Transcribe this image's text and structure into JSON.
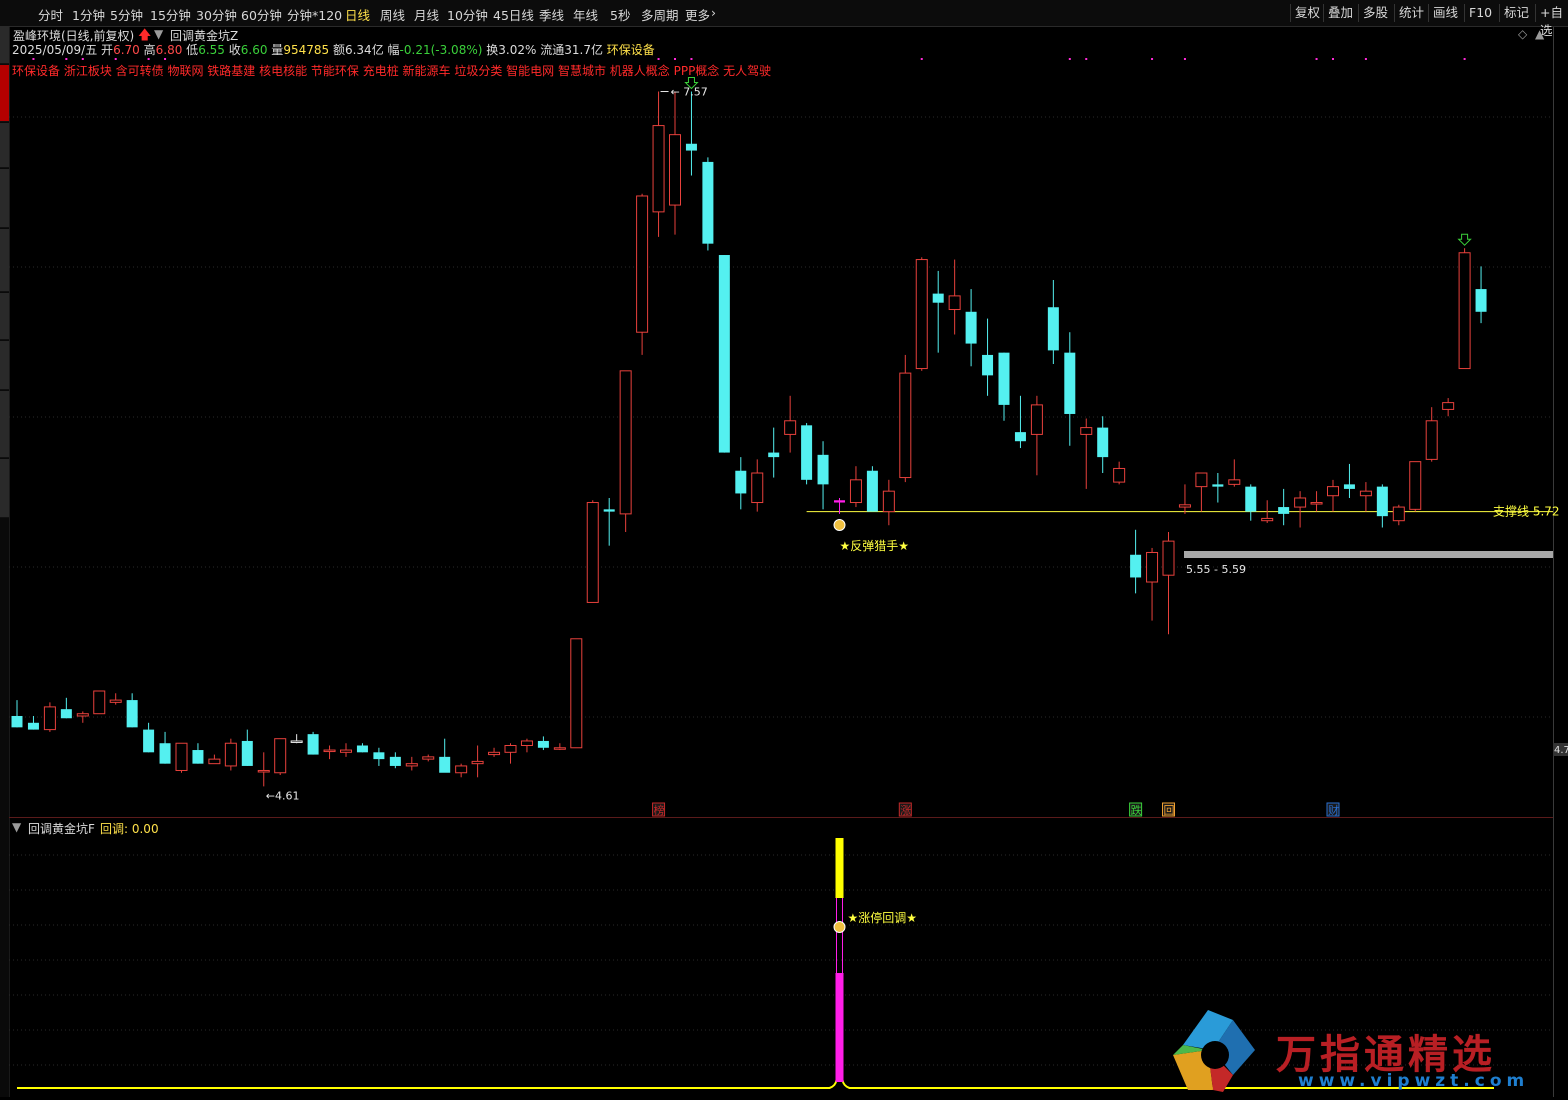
{
  "toolbar": {
    "left": [
      {
        "label": "分时",
        "active": false
      },
      {
        "label": "1分钟",
        "active": false
      },
      {
        "label": "5分钟",
        "active": false
      },
      {
        "label": "15分钟",
        "active": false
      },
      {
        "label": "30分钟",
        "active": false
      },
      {
        "label": "60分钟",
        "active": false
      },
      {
        "label": "分钟*120",
        "active": false
      },
      {
        "label": "日线",
        "active": true
      },
      {
        "label": "周线",
        "active": false
      },
      {
        "label": "月线",
        "active": false
      },
      {
        "label": "10分钟",
        "active": false
      },
      {
        "label": "45日线",
        "active": false
      },
      {
        "label": "季线",
        "active": false
      },
      {
        "label": "年线",
        "active": false
      },
      {
        "label": "5秒",
        "active": false
      },
      {
        "label": "多周期",
        "active": false
      },
      {
        "label": "更多",
        "active": false
      }
    ],
    "right": [
      "复权",
      "叠加",
      "多股",
      "统计",
      "画线",
      "F10",
      "标记",
      "+自选"
    ]
  },
  "header": {
    "stock_title": "盈峰环境(日线,前复权)",
    "indicator_name": "回调黄金坑Z",
    "date": "2025/05/09/五",
    "open_label": "开",
    "open": "6.70",
    "high_label": "高",
    "high": "6.80",
    "low_label": "低",
    "low": "6.55",
    "close_label": "收",
    "close": "6.60",
    "volume_label": "量",
    "volume": "954785",
    "amount_label": "额",
    "amount": "6.34亿",
    "change_label": "幅",
    "change": "-0.21(-3.08%)",
    "turnover_label": "换",
    "turnover": "3.02%",
    "float_label": "流通",
    "float_value": "31.7亿",
    "industry": "环保设备",
    "concepts": "环保设备 浙江板块 含可转债 物联网 铁路基建 核电核能 节能环保 充电桩 新能源车 垃圾分类 智能电网 智慧城市 机器人概念 PPP概念 无人驾驶"
  },
  "main_chart_labels": {
    "high_marker": "7.57",
    "low_marker": "4.61",
    "signal_text": "★反弹猎手★",
    "support_label": "支撑线 5.72",
    "gap_label": "5.55 - 5.59",
    "axis_right_label": "4.7",
    "event_markers": [
      "榜",
      "涨",
      "跌",
      "回",
      "财"
    ]
  },
  "sub_panel": {
    "title": "回调黄金坑F",
    "value_label": "回调: 0.00",
    "signal_text": "★涨停回调★"
  },
  "logo": {
    "text": "万指通精选",
    "url": "www.vipwzt.com"
  },
  "colors": {
    "up": "#e8413c",
    "down": "#54f0f0",
    "signal": "#ff1ee8",
    "yellow": "#ffff00",
    "bg": "#000000"
  },
  "chart_data": {
    "type": "candlestick",
    "support_line": 5.72,
    "gap_zone": [
      5.55,
      5.59
    ],
    "candles": [
      {
        "o": 4.82,
        "h": 4.89,
        "l": 4.77,
        "c": 4.77
      },
      {
        "o": 4.79,
        "h": 4.82,
        "l": 4.76,
        "c": 4.76
      },
      {
        "o": 4.76,
        "h": 4.88,
        "l": 4.75,
        "c": 4.86
      },
      {
        "o": 4.85,
        "h": 4.9,
        "l": 4.81,
        "c": 4.81
      },
      {
        "o": 4.82,
        "h": 4.84,
        "l": 4.79,
        "c": 4.83
      },
      {
        "o": 4.83,
        "h": 4.93,
        "l": 4.83,
        "c": 4.93
      },
      {
        "o": 4.88,
        "h": 4.92,
        "l": 4.87,
        "c": 4.89
      },
      {
        "o": 4.89,
        "h": 4.92,
        "l": 4.77,
        "c": 4.77
      },
      {
        "o": 4.76,
        "h": 4.79,
        "l": 4.66,
        "c": 4.66
      },
      {
        "o": 4.7,
        "h": 4.75,
        "l": 4.61,
        "c": 4.61
      },
      {
        "o": 4.58,
        "h": 4.7,
        "l": 4.57,
        "c": 4.7
      },
      {
        "o": 4.67,
        "h": 4.7,
        "l": 4.61,
        "c": 4.61
      },
      {
        "o": 4.61,
        "h": 4.65,
        "l": 4.61,
        "c": 4.63
      },
      {
        "o": 4.6,
        "h": 4.72,
        "l": 4.58,
        "c": 4.7
      },
      {
        "o": 4.71,
        "h": 4.76,
        "l": 4.6,
        "c": 4.6
      },
      {
        "o": 4.58,
        "h": 4.66,
        "l": 4.51,
        "c": 4.58
      },
      {
        "o": 4.57,
        "h": 4.72,
        "l": 4.56,
        "c": 4.72
      },
      {
        "o": 4.71,
        "h": 4.74,
        "l": 4.7,
        "c": 4.71
      },
      {
        "o": 4.74,
        "h": 4.75,
        "l": 4.65,
        "c": 4.65
      },
      {
        "o": 4.67,
        "h": 4.69,
        "l": 4.63,
        "c": 4.67
      },
      {
        "o": 4.66,
        "h": 4.7,
        "l": 4.64,
        "c": 4.67
      },
      {
        "o": 4.69,
        "h": 4.7,
        "l": 4.66,
        "c": 4.66
      },
      {
        "o": 4.66,
        "h": 4.68,
        "l": 4.6,
        "c": 4.63
      },
      {
        "o": 4.64,
        "h": 4.66,
        "l": 4.59,
        "c": 4.6
      },
      {
        "o": 4.6,
        "h": 4.64,
        "l": 4.58,
        "c": 4.61
      },
      {
        "o": 4.63,
        "h": 4.65,
        "l": 4.62,
        "c": 4.64
      },
      {
        "o": 4.64,
        "h": 4.72,
        "l": 4.58,
        "c": 4.57
      },
      {
        "o": 4.57,
        "h": 4.61,
        "l": 4.55,
        "c": 4.6
      },
      {
        "o": 4.61,
        "h": 4.69,
        "l": 4.55,
        "c": 4.62
      },
      {
        "o": 4.65,
        "h": 4.68,
        "l": 4.64,
        "c": 4.66
      },
      {
        "o": 4.66,
        "h": 4.7,
        "l": 4.61,
        "c": 4.69
      },
      {
        "o": 4.69,
        "h": 4.72,
        "l": 4.66,
        "c": 4.71
      },
      {
        "o": 4.71,
        "h": 4.73,
        "l": 4.67,
        "c": 4.68
      },
      {
        "o": 4.68,
        "h": 4.7,
        "l": 4.67,
        "c": 4.68
      },
      {
        "o": 4.68,
        "h": 5.16,
        "l": 4.68,
        "c": 5.16
      },
      {
        "o": 5.32,
        "h": 5.77,
        "l": 5.32,
        "c": 5.76
      },
      {
        "o": 5.73,
        "h": 5.78,
        "l": 5.57,
        "c": 5.72
      },
      {
        "o": 5.71,
        "h": 6.34,
        "l": 5.63,
        "c": 6.34
      },
      {
        "o": 6.51,
        "h": 7.12,
        "l": 6.41,
        "c": 7.11
      },
      {
        "o": 7.04,
        "h": 7.57,
        "l": 6.93,
        "c": 7.42
      },
      {
        "o": 7.07,
        "h": 7.57,
        "l": 6.94,
        "c": 7.38
      },
      {
        "o": 7.34,
        "h": 7.57,
        "l": 7.2,
        "c": 7.31
      },
      {
        "o": 7.26,
        "h": 7.28,
        "l": 6.87,
        "c": 6.9
      },
      {
        "o": 6.85,
        "h": 6.85,
        "l": 5.98,
        "c": 5.98
      },
      {
        "o": 5.9,
        "h": 5.96,
        "l": 5.73,
        "c": 5.8
      },
      {
        "o": 5.76,
        "h": 5.95,
        "l": 5.72,
        "c": 5.89
      },
      {
        "o": 5.98,
        "h": 6.09,
        "l": 5.87,
        "c": 5.96
      },
      {
        "o": 6.06,
        "h": 6.23,
        "l": 5.98,
        "c": 6.12
      },
      {
        "o": 6.1,
        "h": 6.11,
        "l": 5.84,
        "c": 5.86
      },
      {
        "o": 5.97,
        "h": 6.03,
        "l": 5.73,
        "c": 5.84
      },
      {
        "o": 5.77,
        "h": 5.78,
        "l": 5.71,
        "c": 5.76
      },
      {
        "o": 5.76,
        "h": 5.92,
        "l": 5.74,
        "c": 5.86
      },
      {
        "o": 5.9,
        "h": 5.92,
        "l": 5.72,
        "c": 5.72
      },
      {
        "o": 5.72,
        "h": 5.86,
        "l": 5.66,
        "c": 5.81
      },
      {
        "o": 5.87,
        "h": 6.41,
        "l": 5.85,
        "c": 6.33
      },
      {
        "o": 6.35,
        "h": 6.84,
        "l": 6.34,
        "c": 6.83
      },
      {
        "o": 6.68,
        "h": 6.78,
        "l": 6.42,
        "c": 6.64
      },
      {
        "o": 6.61,
        "h": 6.83,
        "l": 6.5,
        "c": 6.67
      },
      {
        "o": 6.6,
        "h": 6.7,
        "l": 6.36,
        "c": 6.46
      },
      {
        "o": 6.41,
        "h": 6.57,
        "l": 6.23,
        "c": 6.32
      },
      {
        "o": 6.42,
        "h": 6.42,
        "l": 6.12,
        "c": 6.19
      },
      {
        "o": 6.07,
        "h": 6.23,
        "l": 6.0,
        "c": 6.03
      },
      {
        "o": 6.06,
        "h": 6.23,
        "l": 5.88,
        "c": 6.19
      },
      {
        "o": 6.62,
        "h": 6.74,
        "l": 6.37,
        "c": 6.43
      },
      {
        "o": 6.42,
        "h": 6.51,
        "l": 6.01,
        "c": 6.15
      },
      {
        "o": 6.06,
        "h": 6.13,
        "l": 5.82,
        "c": 6.09
      },
      {
        "o": 6.09,
        "h": 6.14,
        "l": 5.89,
        "c": 5.96
      },
      {
        "o": 5.85,
        "h": 5.94,
        "l": 5.84,
        "c": 5.91
      },
      {
        "o": 5.53,
        "h": 5.64,
        "l": 5.36,
        "c": 5.43
      },
      {
        "o": 5.41,
        "h": 5.56,
        "l": 5.24,
        "c": 5.54
      },
      {
        "o": 5.44,
        "h": 5.63,
        "l": 5.18,
        "c": 5.59
      },
      {
        "o": 5.74,
        "h": 5.84,
        "l": 5.71,
        "c": 5.75
      },
      {
        "o": 5.83,
        "h": 5.89,
        "l": 5.72,
        "c": 5.89
      },
      {
        "o": 5.84,
        "h": 5.89,
        "l": 5.76,
        "c": 5.83
      },
      {
        "o": 5.84,
        "h": 5.95,
        "l": 5.83,
        "c": 5.86
      },
      {
        "o": 5.83,
        "h": 5.84,
        "l": 5.68,
        "c": 5.72
      },
      {
        "o": 5.68,
        "h": 5.77,
        "l": 5.67,
        "c": 5.69
      },
      {
        "o": 5.74,
        "h": 5.82,
        "l": 5.66,
        "c": 5.71
      },
      {
        "o": 5.74,
        "h": 5.81,
        "l": 5.65,
        "c": 5.78
      },
      {
        "o": 5.76,
        "h": 5.81,
        "l": 5.72,
        "c": 5.76
      },
      {
        "o": 5.79,
        "h": 5.86,
        "l": 5.72,
        "c": 5.83
      },
      {
        "o": 5.84,
        "h": 5.93,
        "l": 5.78,
        "c": 5.82
      },
      {
        "o": 5.79,
        "h": 5.85,
        "l": 5.72,
        "c": 5.81
      },
      {
        "o": 5.83,
        "h": 5.84,
        "l": 5.65,
        "c": 5.7
      },
      {
        "o": 5.68,
        "h": 5.75,
        "l": 5.66,
        "c": 5.74
      },
      {
        "o": 5.73,
        "h": 5.94,
        "l": 5.72,
        "c": 5.94
      },
      {
        "o": 5.95,
        "h": 6.18,
        "l": 5.94,
        "c": 6.12
      },
      {
        "o": 6.17,
        "h": 6.22,
        "l": 6.14,
        "c": 6.2
      },
      {
        "o": 6.35,
        "h": 6.88,
        "l": 6.35,
        "c": 6.86
      },
      {
        "o": 6.7,
        "h": 6.8,
        "l": 6.55,
        "c": 6.6
      }
    ],
    "highlight_index": 50,
    "down_arrow_indices": [
      41,
      88
    ],
    "flat_x_indices": [
      17,
      18,
      69,
      70
    ],
    "event_marker_indices": [
      39,
      54,
      68,
      70,
      80
    ],
    "y_range": [
      4.45,
      7.7
    ],
    "sub_indicator": {
      "spike_index": 50,
      "spike_top": 1.0,
      "spike_yellow_bottom": 0.76,
      "spike_magenta_top": 0.46,
      "baseline": 0.0
    }
  }
}
